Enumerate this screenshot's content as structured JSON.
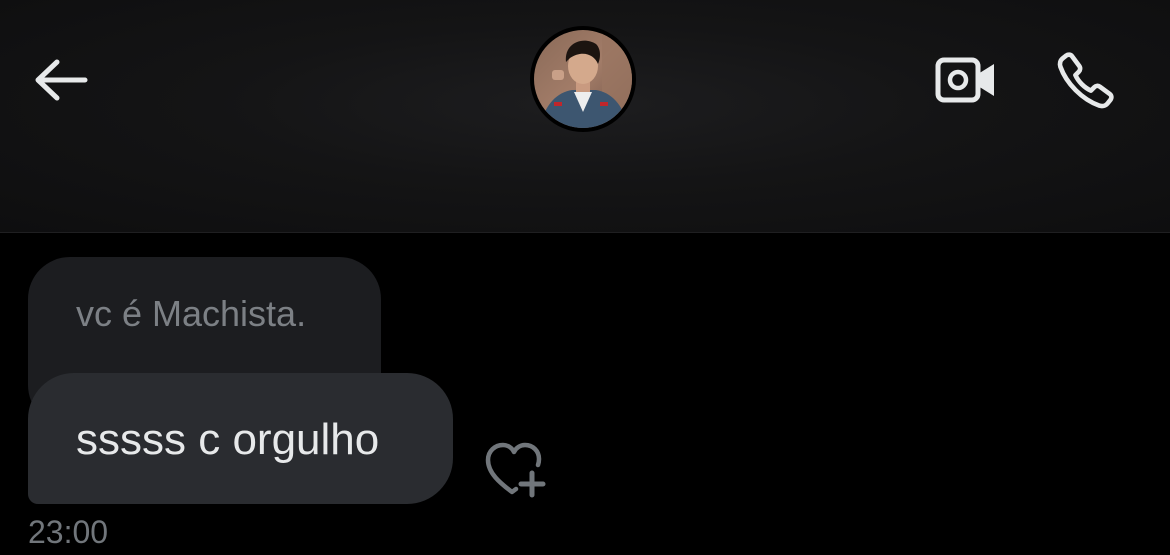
{
  "header": {
    "back_icon": "arrow-left-icon",
    "avatar_icon": "profile-photo",
    "video_icon": "video-camera-icon",
    "call_icon": "phone-icon"
  },
  "messages": {
    "reply_preview": {
      "text": "vc é Machista."
    },
    "main": {
      "text": "sssss c orgulho"
    },
    "reaction_icon": "heart-plus-icon",
    "timestamp": "23:00"
  },
  "colors": {
    "background": "#000000",
    "header_bg": "#141415",
    "bubble_reply_bg": "#1c1d20",
    "bubble_main_bg": "#2a2c30",
    "text_primary": "#e7e9ea",
    "text_muted": "#71767b"
  }
}
